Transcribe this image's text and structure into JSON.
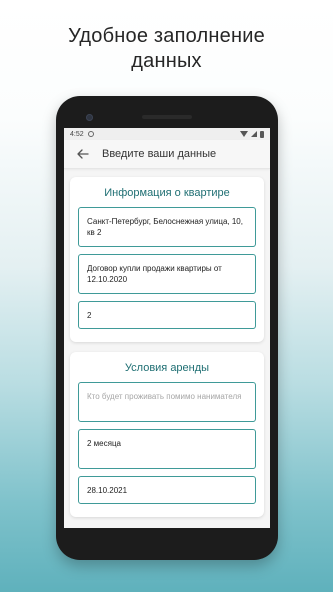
{
  "headline": {
    "line1": "Удобное заполнение",
    "line2": "данных"
  },
  "status_bar": {
    "time": "4:52"
  },
  "app_bar": {
    "title": "Введите ваши данные"
  },
  "sections": [
    {
      "title": "Информация о квартире",
      "fields": [
        {
          "value": "Санкт-Петербург, Белоснежная улица, 10, кв 2"
        },
        {
          "value": "Договор купли продажи квартиры от 12.10.2020"
        },
        {
          "value": "2"
        }
      ]
    },
    {
      "title": "Условия аренды",
      "fields": [
        {
          "placeholder": "Кто будет проживать помимо нанимателя"
        },
        {
          "value": "2 месяца"
        },
        {
          "value": "28.10.2021"
        }
      ]
    }
  ],
  "colors": {
    "accent": "#1f6f73",
    "field_border": "#3f9a98",
    "background_bottom": "#5fb1bc"
  }
}
